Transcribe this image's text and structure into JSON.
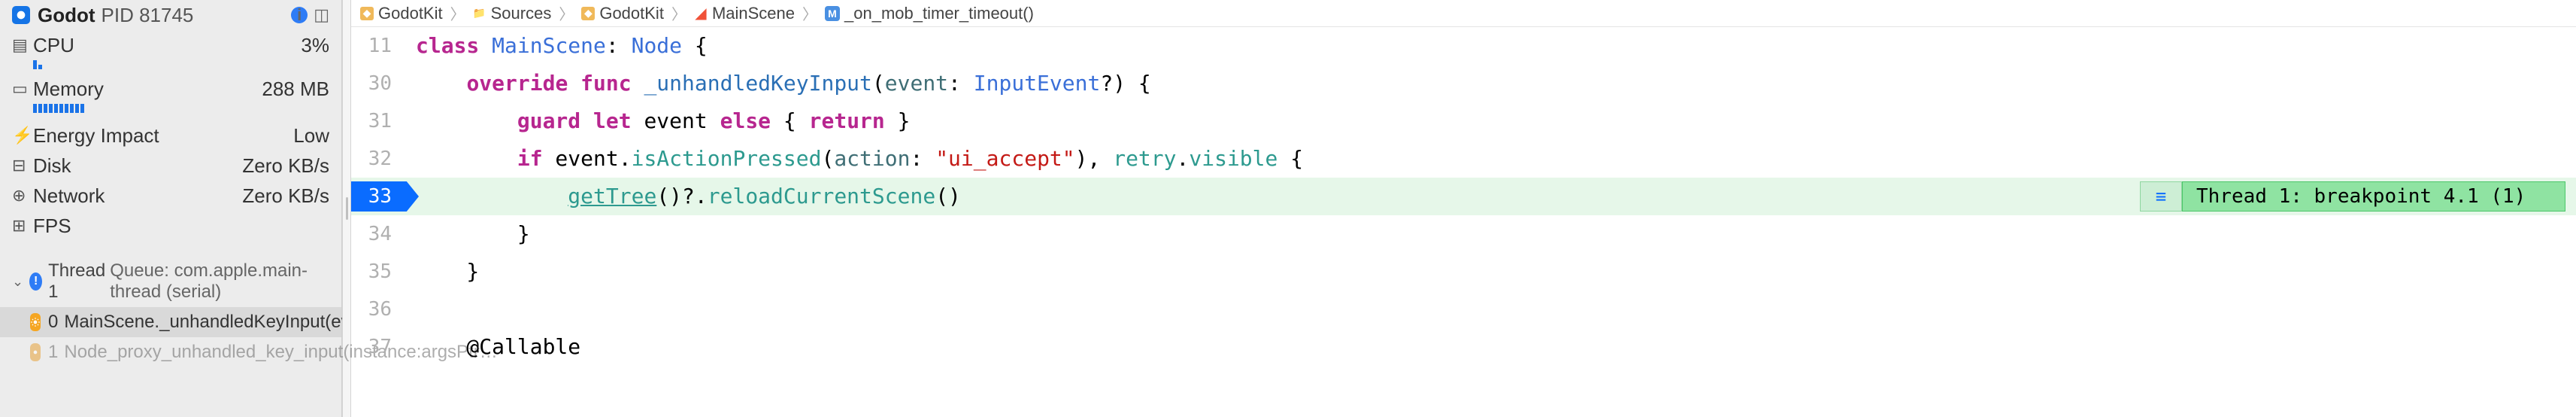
{
  "sidebar": {
    "app_name": "Godot",
    "pid_label": "PID 81745",
    "metrics": {
      "cpu": {
        "label": "CPU",
        "value": "3%"
      },
      "memory": {
        "label": "Memory",
        "value": "288 MB"
      },
      "energy": {
        "label": "Energy Impact",
        "value": "Low"
      },
      "disk": {
        "label": "Disk",
        "value": "Zero KB/s"
      },
      "network": {
        "label": "Network",
        "value": "Zero KB/s"
      },
      "fps": {
        "label": "FPS",
        "value": ""
      }
    },
    "thread": {
      "title": "Thread 1",
      "subtitle": "Queue: com.apple.main-thread (serial)",
      "frames": [
        {
          "index": "0",
          "label": "MainScene._unhandledKeyInput(event:)"
        },
        {
          "index": "1",
          "label": "Node_proxy_unhandled_key_input(instance:argsPtr…"
        }
      ]
    }
  },
  "breadcrumb": {
    "items": [
      {
        "icon": "pkg",
        "label": "GodotKit"
      },
      {
        "icon": "folder",
        "label": "Sources"
      },
      {
        "icon": "pkg",
        "label": "GodotKit"
      },
      {
        "icon": "swift",
        "label": "MainScene"
      },
      {
        "icon": "method",
        "label": "_on_mob_timer_timeout()"
      }
    ]
  },
  "code": {
    "lines": [
      {
        "n": "11",
        "tokens": [
          [
            "kw",
            "class"
          ],
          [
            "plain",
            " "
          ],
          [
            "type",
            "MainScene"
          ],
          [
            "punc",
            ": "
          ],
          [
            "type",
            "Node"
          ],
          [
            "punc",
            " {"
          ]
        ]
      },
      {
        "n": "30",
        "tokens": [
          [
            "plain",
            "    "
          ],
          [
            "kw",
            "override"
          ],
          [
            "plain",
            " "
          ],
          [
            "kw",
            "func"
          ],
          [
            "plain",
            " "
          ],
          [
            "fn-def",
            "_unhandledKeyInput"
          ],
          [
            "punc",
            "("
          ],
          [
            "ident",
            "event"
          ],
          [
            "punc",
            ": "
          ],
          [
            "type",
            "InputEvent"
          ],
          [
            "punc",
            "?"
          ],
          [
            "punc",
            ") {"
          ]
        ]
      },
      {
        "n": "31",
        "tokens": [
          [
            "plain",
            "        "
          ],
          [
            "kw",
            "guard"
          ],
          [
            "plain",
            " "
          ],
          [
            "kw",
            "let"
          ],
          [
            "plain",
            " "
          ],
          [
            "plain",
            "event "
          ],
          [
            "kw",
            "else"
          ],
          [
            "punc",
            " { "
          ],
          [
            "kw",
            "return"
          ],
          [
            "punc",
            " }"
          ]
        ]
      },
      {
        "n": "32",
        "tokens": [
          [
            "plain",
            "        "
          ],
          [
            "kw",
            "if"
          ],
          [
            "plain",
            " event."
          ],
          [
            "teal",
            "isActionPressed"
          ],
          [
            "punc",
            "("
          ],
          [
            "ident",
            "action"
          ],
          [
            "punc",
            ": "
          ],
          [
            "str",
            "\"ui_accept\""
          ],
          [
            "punc",
            "), "
          ],
          [
            "teal",
            "retry"
          ],
          [
            "punc",
            "."
          ],
          [
            "teal",
            "visible"
          ],
          [
            "punc",
            " {"
          ]
        ]
      },
      {
        "n": "33",
        "tokens": [
          [
            "plain",
            "            "
          ],
          [
            "teal underline",
            "getTree"
          ],
          [
            "punc",
            "()?."
          ],
          [
            "teal",
            "reloadCurrentScene"
          ],
          [
            "punc",
            "()"
          ]
        ],
        "highlight": true,
        "breakpoint": true,
        "indicator": "Thread 1: breakpoint 4.1 (1)"
      },
      {
        "n": "34",
        "tokens": [
          [
            "plain",
            "        }"
          ]
        ]
      },
      {
        "n": "35",
        "tokens": [
          [
            "plain",
            "    }"
          ]
        ]
      },
      {
        "n": "36",
        "tokens": [
          [
            "plain",
            ""
          ]
        ]
      },
      {
        "n": "37",
        "tokens": [
          [
            "plain",
            "    @Callable"
          ]
        ]
      }
    ]
  }
}
